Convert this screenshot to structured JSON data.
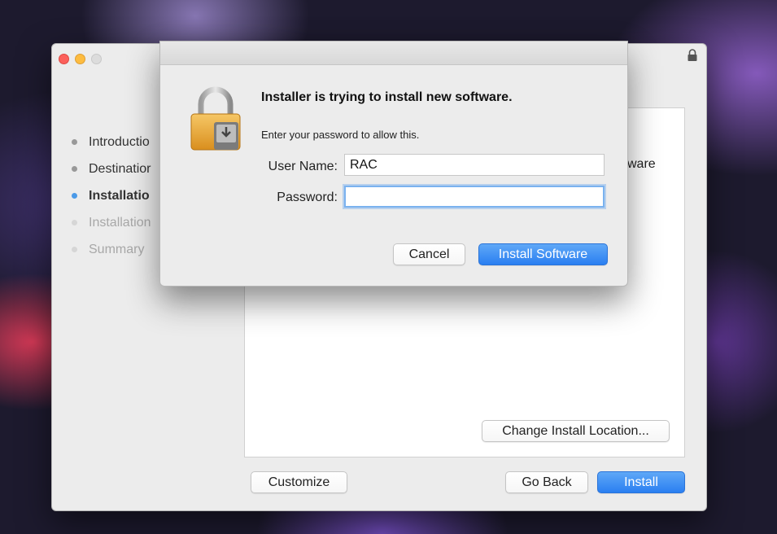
{
  "installer": {
    "steps": [
      {
        "label": "Introductio",
        "state": "done"
      },
      {
        "label": "Destinatior",
        "state": "done"
      },
      {
        "label": "Installatio",
        "state": "current"
      },
      {
        "label": "Installation",
        "state": "pending"
      },
      {
        "label": "Summary",
        "state": "pending"
      }
    ],
    "content_fragment": "ware",
    "change_location_label": "Change Install Location...",
    "customize_label": "Customize",
    "go_back_label": "Go Back",
    "install_label": "Install"
  },
  "dialog": {
    "title": "Installer is trying to install new software.",
    "message": "Enter your password to allow this.",
    "username_label": "User Name:",
    "username_value": "RAC",
    "password_label": "Password:",
    "password_value": "",
    "cancel_label": "Cancel",
    "install_software_label": "Install Software"
  },
  "colors": {
    "accent": "#2a7ff1",
    "current_step_dot": "#4b9ae8",
    "close": "#fc605b",
    "minimize": "#fdbc40"
  },
  "icons": {
    "titlebar": "lock-icon",
    "dialog": "package-lock-icon"
  }
}
